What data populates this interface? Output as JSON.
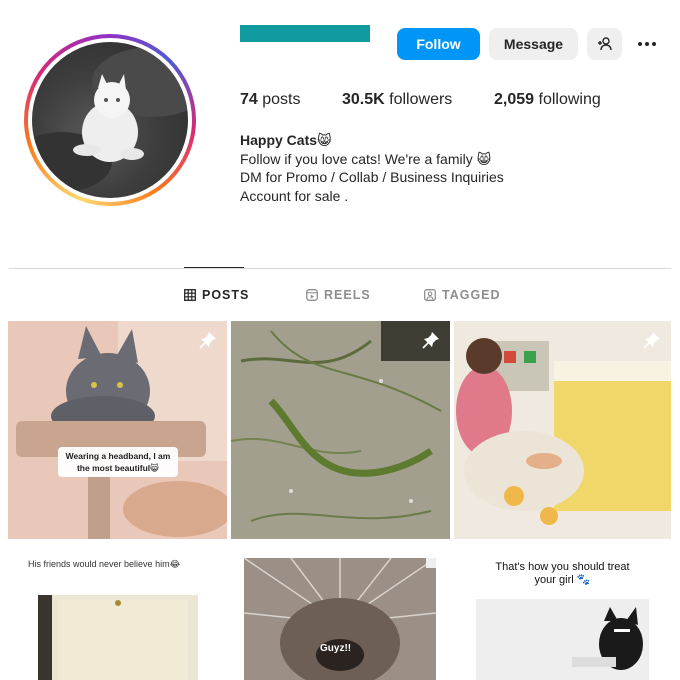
{
  "profile": {
    "username_redacted_color": "#119aa0",
    "follow_label": "Follow",
    "message_label": "Message",
    "accent_color": "#0095f6"
  },
  "stats": {
    "posts_count": "74",
    "posts_label": "posts",
    "followers_count": "30.5K",
    "followers_label": "followers",
    "following_count": "2,059",
    "following_label": "following"
  },
  "bio": {
    "name": "Happy Cats😸",
    "line1": "Follow if you love cats! We're a family 😸",
    "line2": "DM for Promo / Collab / Business Inquiries",
    "line3": "Account for sale ."
  },
  "tabs": [
    {
      "label": "POSTS",
      "icon": "grid-icon",
      "active": true
    },
    {
      "label": "REELS",
      "icon": "reels-icon",
      "active": false
    },
    {
      "label": "TAGGED",
      "icon": "tagged-icon",
      "active": false
    }
  ],
  "posts": [
    {
      "caption": "Wearing a headband, I am the most beautiful😸",
      "pinned": true
    },
    {
      "caption": "",
      "pinned": true
    },
    {
      "caption": "",
      "pinned": true
    },
    {
      "caption": "His friends would never believe him😂",
      "pinned": false
    },
    {
      "caption": "Guyz!!",
      "pinned": false
    },
    {
      "caption": "That's how you should treat your girl 🐾",
      "pinned": false
    }
  ]
}
